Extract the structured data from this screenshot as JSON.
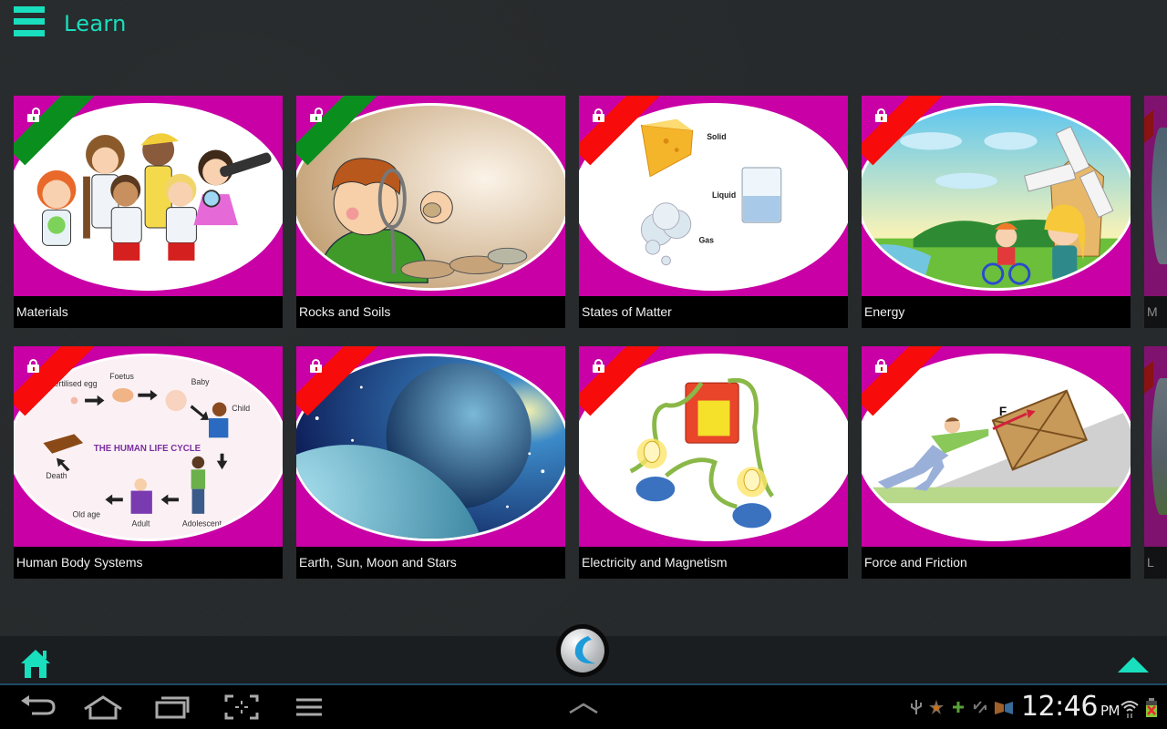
{
  "header": {
    "title": "Learn",
    "menu_icon": "hamburger-menu-icon"
  },
  "colors": {
    "accent": "#19dfbe",
    "card_frame": "#c800a5",
    "unlocked_ribbon": "#0a8f1e",
    "locked_ribbon": "#f70b0b",
    "label_bg": "#000000"
  },
  "topics": [
    {
      "label": "Materials",
      "locked": false,
      "icon": "children-scientists-illustration"
    },
    {
      "label": "Rocks and Soils",
      "locked": false,
      "icon": "boy-magnifying-glass-rocks-illustration"
    },
    {
      "label": "States of Matter",
      "locked": true,
      "icon": "solid-liquid-gas-illustration",
      "image_text": {
        "solid": "Solid",
        "liquid": "Liquid",
        "gas": "Gas"
      }
    },
    {
      "label": "Energy",
      "locked": true,
      "icon": "windmill-children-illustration"
    },
    {
      "label": "Human Body Systems",
      "locked": true,
      "icon": "human-life-cycle-illustration",
      "image_text": {
        "title": "THE HUMAN LIFE CYCLE",
        "stages": [
          "Fertilised egg",
          "Foetus",
          "Baby",
          "Child",
          "Adolescent",
          "Adult",
          "Old age",
          "Death"
        ]
      }
    },
    {
      "label": "Earth, Sun, Moon and Stars",
      "locked": true,
      "icon": "earth-moon-space-illustration"
    },
    {
      "label": "Electricity and Magnetism",
      "locked": true,
      "icon": "battery-bulbs-circuit-illustration"
    },
    {
      "label": "Force and Friction",
      "locked": true,
      "icon": "man-pushing-crate-illustration",
      "image_text": {
        "force": "F"
      }
    }
  ],
  "partial_topics": [
    {
      "label": "M",
      "locked": true
    },
    {
      "label": "L",
      "locked": true
    }
  ],
  "bottom_bar": {
    "home_icon": "home-icon",
    "center_logo": "app-logo-button",
    "scroll_up_icon": "scroll-up-triangle-icon"
  },
  "system_nav": {
    "buttons": [
      "back",
      "home",
      "recent-apps",
      "screenshot",
      "menu"
    ],
    "center": "show-more-chevron",
    "status_icons": [
      "usb",
      "star",
      "plus",
      "sync",
      "media"
    ],
    "time": "12:46",
    "ampm": "PM"
  }
}
